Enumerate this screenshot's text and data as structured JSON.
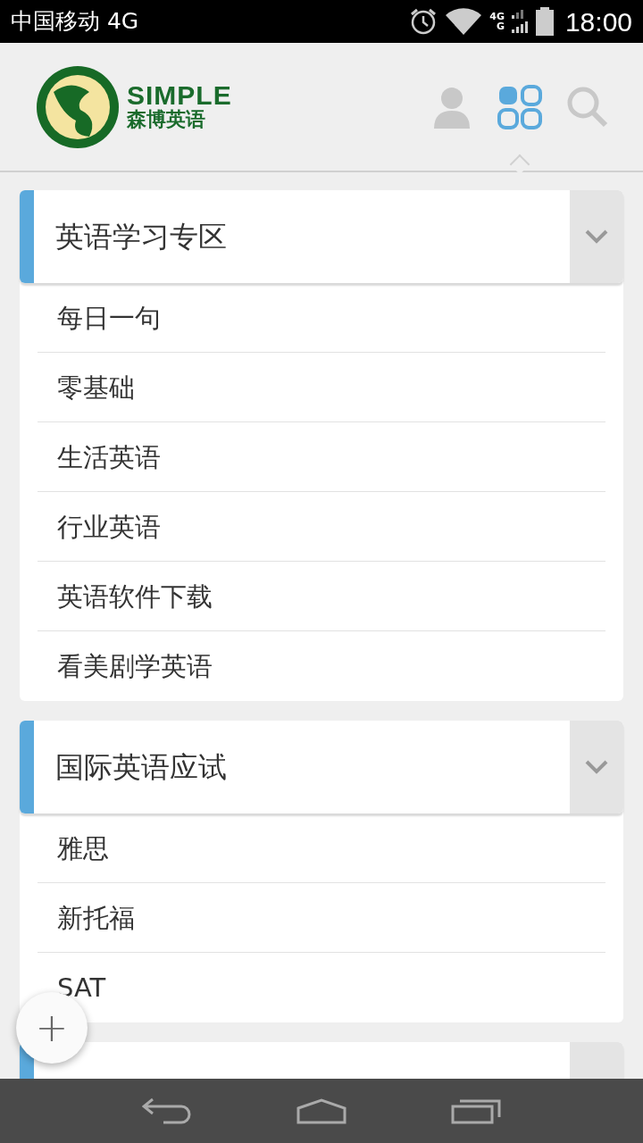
{
  "status_bar": {
    "carrier": "中国移动 4G",
    "network_small_top": "4G",
    "network_small_bottom": "G",
    "time": "18:00"
  },
  "header": {
    "logo_text": "SIMPLE",
    "logo_subtitle": "森博英语",
    "tabs": [
      {
        "kind": "user",
        "selected": false
      },
      {
        "kind": "grid",
        "selected": true
      },
      {
        "kind": "search",
        "selected": false
      }
    ]
  },
  "sections": [
    {
      "title": "英语学习专区",
      "expanded": true,
      "items": [
        "每日一句",
        "零基础",
        "生活英语",
        "行业英语",
        "英语软件下载",
        "看美剧学英语"
      ]
    },
    {
      "title": "国际英语应试",
      "expanded": true,
      "items": [
        "雅思",
        "新托福",
        "SAT"
      ]
    }
  ],
  "fab": {
    "label": "+"
  }
}
